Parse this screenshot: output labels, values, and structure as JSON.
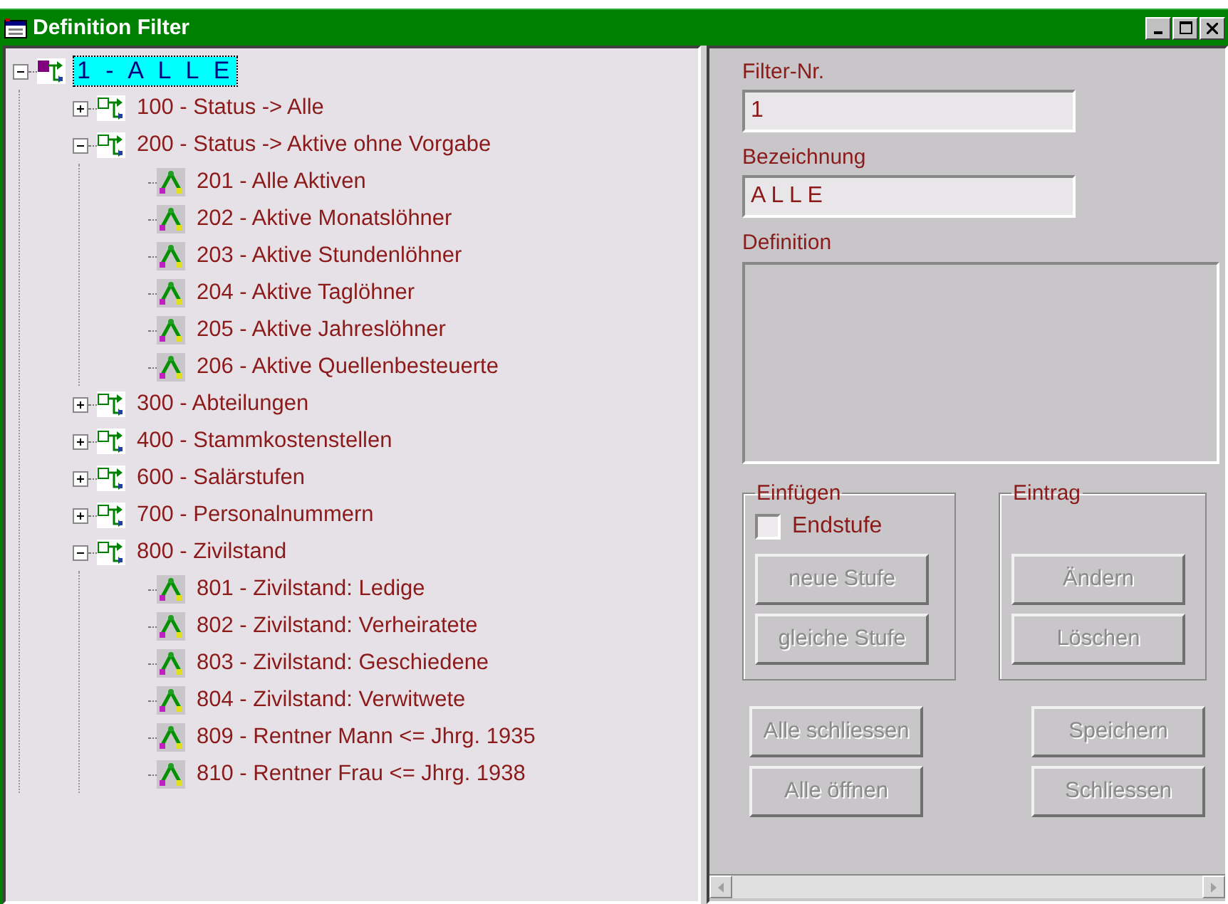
{
  "window": {
    "title": "Definition Filter"
  },
  "tree": [
    {
      "label": "1 - A L L E",
      "kind": "root",
      "expanded": true,
      "selected": true,
      "children": [
        {
          "label": "100 - Status -> Alle",
          "kind": "group",
          "expanded": false,
          "selected": false
        },
        {
          "label": "200 - Status -> Aktive ohne Vorgabe",
          "kind": "group",
          "expanded": true,
          "selected": false,
          "children": [
            {
              "label": "201 - Alle Aktiven",
              "kind": "leaf",
              "selected": false
            },
            {
              "label": "202 - Aktive Monatslöhner",
              "kind": "leaf",
              "selected": false
            },
            {
              "label": "203 - Aktive Stundenlöhner",
              "kind": "leaf",
              "selected": false
            },
            {
              "label": "204 - Aktive Taglöhner",
              "kind": "leaf",
              "selected": false
            },
            {
              "label": "205 - Aktive Jahreslöhner",
              "kind": "leaf",
              "selected": false
            },
            {
              "label": "206 - Aktive Quellenbesteuerte",
              "kind": "leaf",
              "selected": false
            }
          ]
        },
        {
          "label": "300 - Abteilungen",
          "kind": "group",
          "expanded": false,
          "selected": false
        },
        {
          "label": "400 - Stammkostenstellen",
          "kind": "group",
          "expanded": false,
          "selected": false
        },
        {
          "label": "600 - Salärstufen",
          "kind": "group",
          "expanded": false,
          "selected": false
        },
        {
          "label": "700 - Personalnummern",
          "kind": "group",
          "expanded": false,
          "selected": false
        },
        {
          "label": "800 - Zivilstand",
          "kind": "group",
          "expanded": true,
          "selected": false,
          "children": [
            {
              "label": "801 - Zivilstand: Ledige",
              "kind": "leaf",
              "selected": false
            },
            {
              "label": "802 - Zivilstand: Verheiratete",
              "kind": "leaf",
              "selected": false
            },
            {
              "label": "803 - Zivilstand: Geschiedene",
              "kind": "leaf",
              "selected": false
            },
            {
              "label": "804 - Zivilstand: Verwitwete",
              "kind": "leaf",
              "selected": false
            },
            {
              "label": "809 - Rentner Mann <= Jhrg. 1935",
              "kind": "leaf",
              "selected": false
            },
            {
              "label": "810 - Rentner Frau <= Jhrg. 1938",
              "kind": "leaf",
              "selected": false
            }
          ]
        }
      ]
    }
  ],
  "form": {
    "filter_nr": {
      "label": "Filter-Nr.",
      "value": "1"
    },
    "bezeichnung": {
      "label": "Bezeichnung",
      "value": "A L L E"
    },
    "definition": {
      "label": "Definition"
    }
  },
  "einfuegen": {
    "title": "Einfügen",
    "endstufe": {
      "label": "Endstufe",
      "checked": false
    },
    "buttons": [
      {
        "label": "neue Stufe",
        "disabled": true
      },
      {
        "label": "gleiche Stufe",
        "disabled": true
      }
    ]
  },
  "eintrag": {
    "title": "Eintrag",
    "buttons": [
      {
        "label": "Ändern",
        "disabled": true
      },
      {
        "label": "Löschen",
        "disabled": true
      }
    ]
  },
  "bottom_left": [
    {
      "label": "Alle schliessen",
      "disabled": true
    },
    {
      "label": "Alle öffnen",
      "disabled": true
    }
  ],
  "bottom_right": [
    {
      "label": "Speichern",
      "disabled": true
    },
    {
      "label": "Schliessen",
      "disabled": true
    }
  ]
}
